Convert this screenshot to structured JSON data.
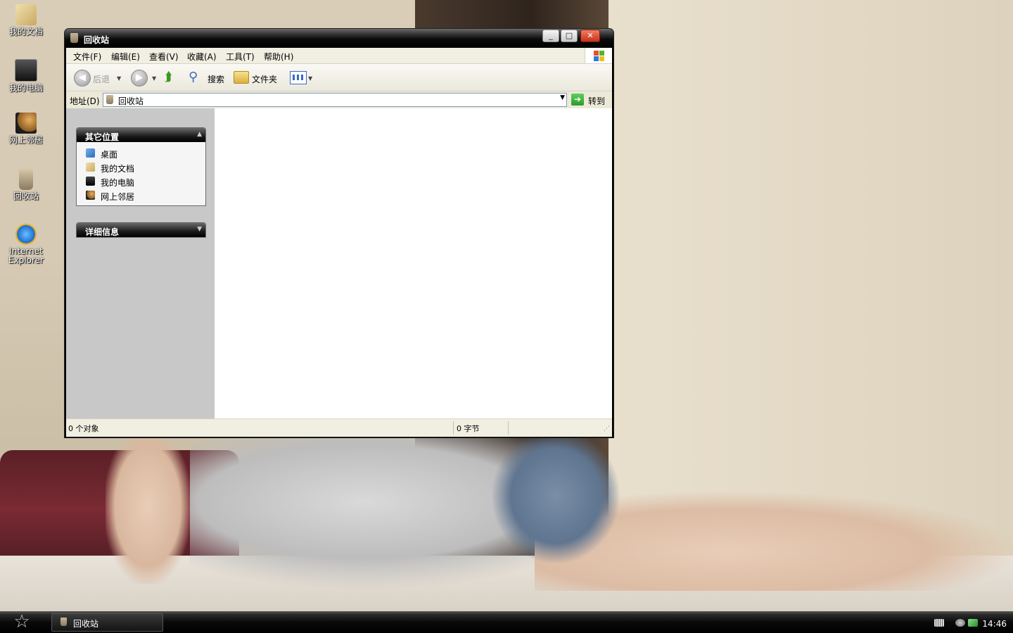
{
  "desktop": {
    "icons": [
      {
        "label": "我的文档"
      },
      {
        "label": "我的电脑"
      },
      {
        "label": "网上邻居"
      },
      {
        "label": "回收站"
      },
      {
        "label": "Internet Explorer"
      }
    ]
  },
  "window": {
    "title": "回收站",
    "controls": {
      "minimize": "_",
      "maximize": "□",
      "close": "✕"
    },
    "menu": [
      {
        "label": "文件(F)"
      },
      {
        "label": "编辑(E)"
      },
      {
        "label": "查看(V)"
      },
      {
        "label": "收藏(A)"
      },
      {
        "label": "工具(T)"
      },
      {
        "label": "帮助(H)"
      }
    ],
    "toolbar": {
      "back_label": "后退",
      "search_label": "搜索",
      "folders_label": "文件夹"
    },
    "address": {
      "label": "地址(D)",
      "value": "回收站",
      "go_label": "转到"
    },
    "tasks": {
      "other_places": {
        "title": "其它位置",
        "items": [
          {
            "label": "桌面"
          },
          {
            "label": "我的文档"
          },
          {
            "label": "我的电脑"
          },
          {
            "label": "网上邻居"
          }
        ]
      },
      "details": {
        "title": "详细信息"
      }
    },
    "status": {
      "objects": "0 个对象",
      "size": "0 字节"
    }
  },
  "taskbar": {
    "task_button": "回收站",
    "clock": "14:46"
  }
}
